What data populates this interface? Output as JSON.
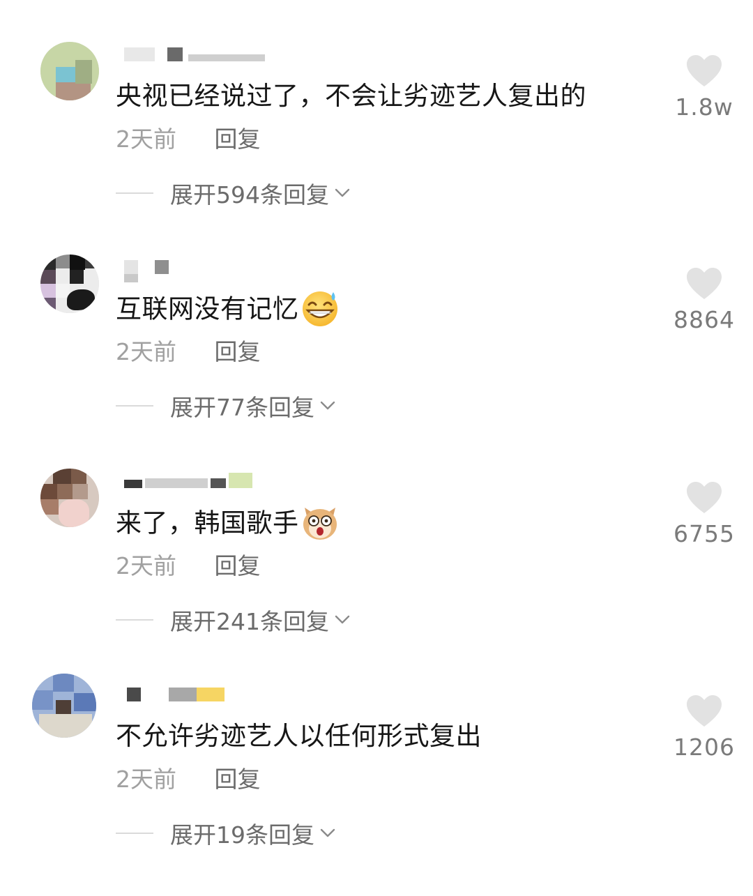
{
  "comments": [
    {
      "text": "央视已经说过了，不会让劣迹艺人复出的",
      "emoji": "",
      "time": "2天前",
      "reply_label": "回复",
      "expand_label": "展开594条回复",
      "likes": "1.8w"
    },
    {
      "text": "互联网没有记忆",
      "emoji": "grin-sweat-emoji",
      "time": "2天前",
      "reply_label": "回复",
      "expand_label": "展开77条回复",
      "likes": "8864"
    },
    {
      "text": "来了，韩国歌手",
      "emoji": "shocked-cat-emoji",
      "time": "2天前",
      "reply_label": "回复",
      "expand_label": "展开241条回复",
      "likes": "6755"
    },
    {
      "text": "不允许劣迹艺人以任何形式复出",
      "emoji": "",
      "time": "2天前",
      "reply_label": "回复",
      "expand_label": "展开19条回复",
      "likes": "1206"
    }
  ],
  "icons": {
    "like": "heart-icon",
    "expand": "chevron-down-icon"
  },
  "colors": {
    "text": "#161616",
    "muted": "#a0a0a0",
    "reply": "#6b6b6b",
    "heart": "#e2e2e2"
  }
}
